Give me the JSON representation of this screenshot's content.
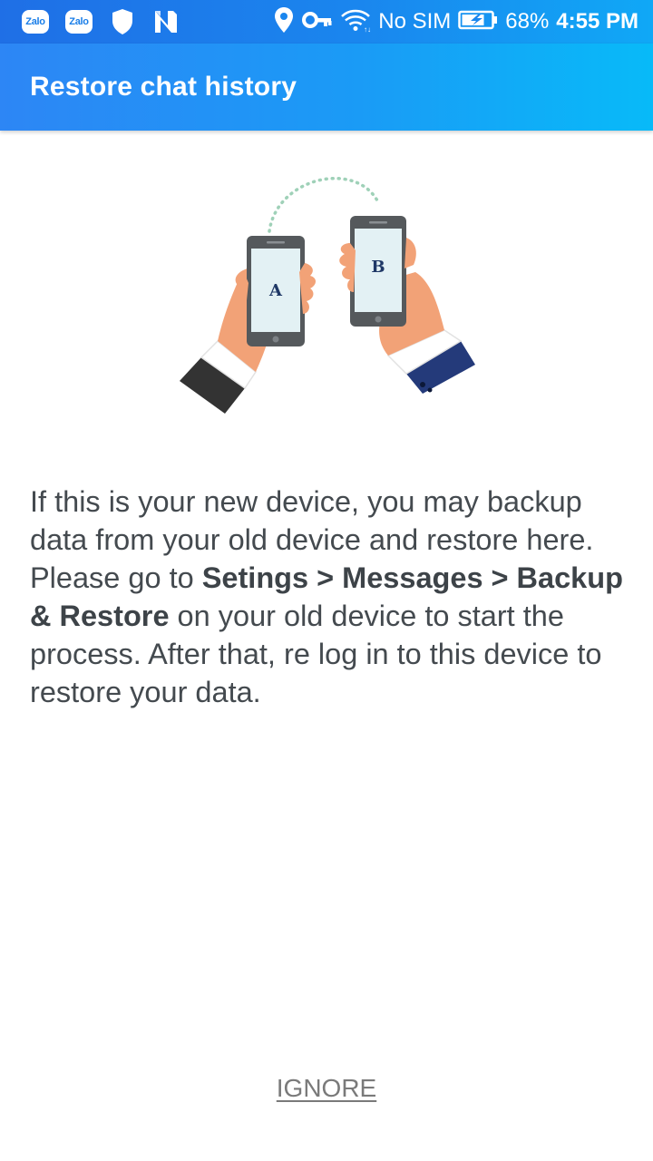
{
  "status_bar": {
    "notifications": [
      {
        "icon": "zalo-icon",
        "label": "Zalo"
      },
      {
        "icon": "zalo-icon",
        "label": "Zalo"
      },
      {
        "icon": "shield-icon"
      },
      {
        "icon": "n-icon"
      }
    ],
    "carrier": "No SIM",
    "battery_percent": "68%",
    "time": "4:55 PM",
    "icons": [
      "location-icon",
      "vpn-key-icon",
      "wifi-icon",
      "battery-charging-icon"
    ]
  },
  "app_bar": {
    "title": "Restore chat history"
  },
  "illustration": {
    "phone_a_label": "A",
    "phone_b_label": "B"
  },
  "message": {
    "part1": "If this is your new device, you may backup data from your old device and restore here. Please go to ",
    "bold_path": "Setings > Messages > Backup & Restore",
    "part2": " on your old device to start the process. After that, re log in to this device to restore your data."
  },
  "actions": {
    "ignore_label": "IGNORE"
  },
  "colors": {
    "status_bar": "#1a86ee",
    "app_bar_start": "#2d86f5",
    "app_bar_end": "#08baf8",
    "body_text": "#444a4f",
    "ignore_text": "#7a7a7a"
  }
}
